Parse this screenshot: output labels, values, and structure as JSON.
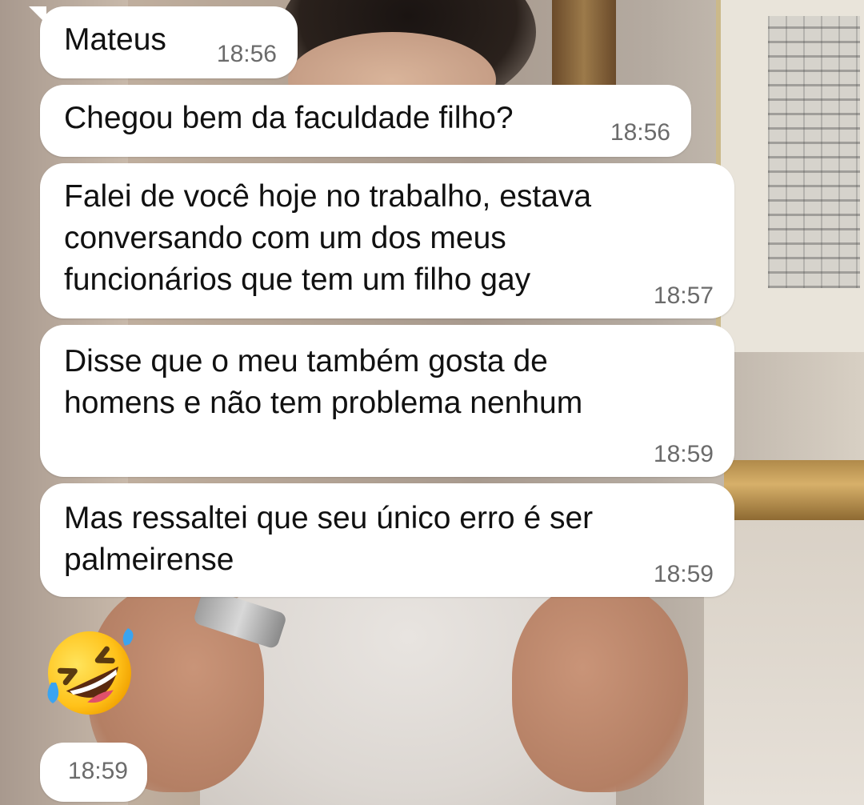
{
  "chat": {
    "messages": [
      {
        "text": "Mateus",
        "time": "18:56"
      },
      {
        "text": "Chegou bem da faculdade filho?",
        "time": "18:56"
      },
      {
        "text": "Falei de você hoje no trabalho, estava\nconversando com um dos meus\nfuncionários que tem um filho gay",
        "time": "18:57"
      },
      {
        "text": "Disse que o meu também gosta de\nhomens e não tem problema nenhum",
        "time": "18:59"
      },
      {
        "text": "Mas ressaltei que seu único erro é ser\npalmeirense",
        "time": "18:59"
      }
    ],
    "emoji_message": {
      "emoji": "rolling-on-the-floor-laughing",
      "time": "18:59"
    }
  },
  "colors": {
    "bubble": "#ffffff",
    "text": "#111111",
    "timestamp": "#6b6b6b"
  }
}
